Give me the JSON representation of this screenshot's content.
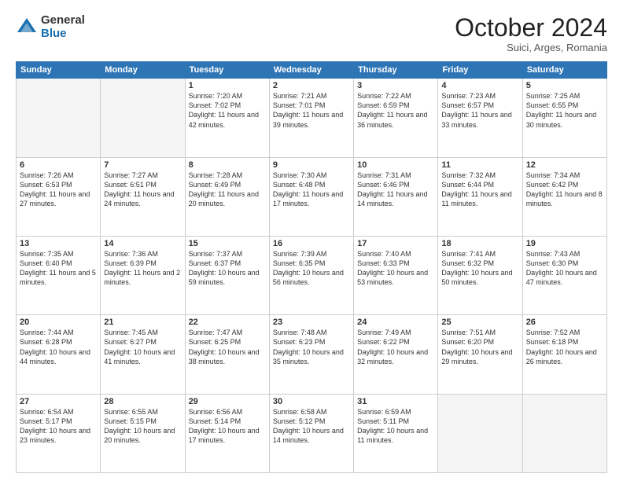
{
  "logo": {
    "general": "General",
    "blue": "Blue"
  },
  "title": "October 2024",
  "subtitle": "Suici, Arges, Romania",
  "headers": [
    "Sunday",
    "Monday",
    "Tuesday",
    "Wednesday",
    "Thursday",
    "Friday",
    "Saturday"
  ],
  "weeks": [
    [
      {
        "day": "",
        "empty": true
      },
      {
        "day": "",
        "empty": true
      },
      {
        "day": "1",
        "info": "Sunrise: 7:20 AM\nSunset: 7:02 PM\nDaylight: 11 hours and 42 minutes."
      },
      {
        "day": "2",
        "info": "Sunrise: 7:21 AM\nSunset: 7:01 PM\nDaylight: 11 hours and 39 minutes."
      },
      {
        "day": "3",
        "info": "Sunrise: 7:22 AM\nSunset: 6:59 PM\nDaylight: 11 hours and 36 minutes."
      },
      {
        "day": "4",
        "info": "Sunrise: 7:23 AM\nSunset: 6:57 PM\nDaylight: 11 hours and 33 minutes."
      },
      {
        "day": "5",
        "info": "Sunrise: 7:25 AM\nSunset: 6:55 PM\nDaylight: 11 hours and 30 minutes."
      }
    ],
    [
      {
        "day": "6",
        "info": "Sunrise: 7:26 AM\nSunset: 6:53 PM\nDaylight: 11 hours and 27 minutes."
      },
      {
        "day": "7",
        "info": "Sunrise: 7:27 AM\nSunset: 6:51 PM\nDaylight: 11 hours and 24 minutes."
      },
      {
        "day": "8",
        "info": "Sunrise: 7:28 AM\nSunset: 6:49 PM\nDaylight: 11 hours and 20 minutes."
      },
      {
        "day": "9",
        "info": "Sunrise: 7:30 AM\nSunset: 6:48 PM\nDaylight: 11 hours and 17 minutes."
      },
      {
        "day": "10",
        "info": "Sunrise: 7:31 AM\nSunset: 6:46 PM\nDaylight: 11 hours and 14 minutes."
      },
      {
        "day": "11",
        "info": "Sunrise: 7:32 AM\nSunset: 6:44 PM\nDaylight: 11 hours and 11 minutes."
      },
      {
        "day": "12",
        "info": "Sunrise: 7:34 AM\nSunset: 6:42 PM\nDaylight: 11 hours and 8 minutes."
      }
    ],
    [
      {
        "day": "13",
        "info": "Sunrise: 7:35 AM\nSunset: 6:40 PM\nDaylight: 11 hours and 5 minutes."
      },
      {
        "day": "14",
        "info": "Sunrise: 7:36 AM\nSunset: 6:39 PM\nDaylight: 11 hours and 2 minutes."
      },
      {
        "day": "15",
        "info": "Sunrise: 7:37 AM\nSunset: 6:37 PM\nDaylight: 10 hours and 59 minutes."
      },
      {
        "day": "16",
        "info": "Sunrise: 7:39 AM\nSunset: 6:35 PM\nDaylight: 10 hours and 56 minutes."
      },
      {
        "day": "17",
        "info": "Sunrise: 7:40 AM\nSunset: 6:33 PM\nDaylight: 10 hours and 53 minutes."
      },
      {
        "day": "18",
        "info": "Sunrise: 7:41 AM\nSunset: 6:32 PM\nDaylight: 10 hours and 50 minutes."
      },
      {
        "day": "19",
        "info": "Sunrise: 7:43 AM\nSunset: 6:30 PM\nDaylight: 10 hours and 47 minutes."
      }
    ],
    [
      {
        "day": "20",
        "info": "Sunrise: 7:44 AM\nSunset: 6:28 PM\nDaylight: 10 hours and 44 minutes."
      },
      {
        "day": "21",
        "info": "Sunrise: 7:45 AM\nSunset: 6:27 PM\nDaylight: 10 hours and 41 minutes."
      },
      {
        "day": "22",
        "info": "Sunrise: 7:47 AM\nSunset: 6:25 PM\nDaylight: 10 hours and 38 minutes."
      },
      {
        "day": "23",
        "info": "Sunrise: 7:48 AM\nSunset: 6:23 PM\nDaylight: 10 hours and 35 minutes."
      },
      {
        "day": "24",
        "info": "Sunrise: 7:49 AM\nSunset: 6:22 PM\nDaylight: 10 hours and 32 minutes."
      },
      {
        "day": "25",
        "info": "Sunrise: 7:51 AM\nSunset: 6:20 PM\nDaylight: 10 hours and 29 minutes."
      },
      {
        "day": "26",
        "info": "Sunrise: 7:52 AM\nSunset: 6:18 PM\nDaylight: 10 hours and 26 minutes."
      }
    ],
    [
      {
        "day": "27",
        "info": "Sunrise: 6:54 AM\nSunset: 5:17 PM\nDaylight: 10 hours and 23 minutes."
      },
      {
        "day": "28",
        "info": "Sunrise: 6:55 AM\nSunset: 5:15 PM\nDaylight: 10 hours and 20 minutes."
      },
      {
        "day": "29",
        "info": "Sunrise: 6:56 AM\nSunset: 5:14 PM\nDaylight: 10 hours and 17 minutes."
      },
      {
        "day": "30",
        "info": "Sunrise: 6:58 AM\nSunset: 5:12 PM\nDaylight: 10 hours and 14 minutes."
      },
      {
        "day": "31",
        "info": "Sunrise: 6:59 AM\nSunset: 5:11 PM\nDaylight: 10 hours and 11 minutes."
      },
      {
        "day": "",
        "empty": true
      },
      {
        "day": "",
        "empty": true
      }
    ]
  ]
}
